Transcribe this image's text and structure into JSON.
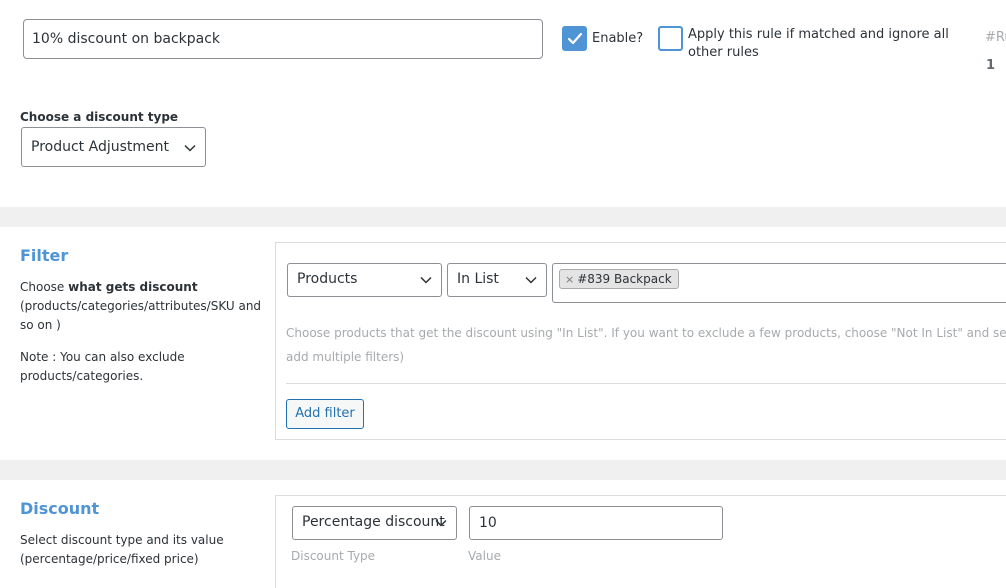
{
  "rule": {
    "name_value": "10% discount on backpack",
    "enable_label": "Enable?",
    "enable_checked": true,
    "exclusive_label": "Apply this rule if matched and ignore all other rules",
    "exclusive_checked": false,
    "id_label": "#Ru",
    "id_value": "1"
  },
  "discount_type": {
    "label": "Choose a discount type",
    "selected": "Product Adjustment"
  },
  "filter": {
    "title": "Filter",
    "desc_prefix": "Choose ",
    "desc_bold": "what gets discount",
    "desc_suffix": " (products/categories/attributes/SKU and so on )",
    "note": "Note : You can also exclude products/categories.",
    "type_selected": "Products",
    "condition_selected": "In List",
    "tag_remove": "×",
    "tag_label": "#839 Backpack",
    "help_line1": "Choose products that get the discount using \"In List\". If you want to exclude a few products, choose \"Not In List\" and select the produ",
    "help_line2": "add multiple filters)",
    "add_button": "Add filter"
  },
  "discount": {
    "title": "Discount",
    "desc": "Select discount type and its value (percentage/price/fixed price)",
    "kind_selected": "Percentage discount",
    "value": "10",
    "kind_caption": "Discount Type",
    "value_caption": "Value"
  },
  "colors": {
    "accent": "#4f94d4",
    "button": "#2271b1",
    "band": "#f0f0f1",
    "muted": "#a7aaad"
  }
}
